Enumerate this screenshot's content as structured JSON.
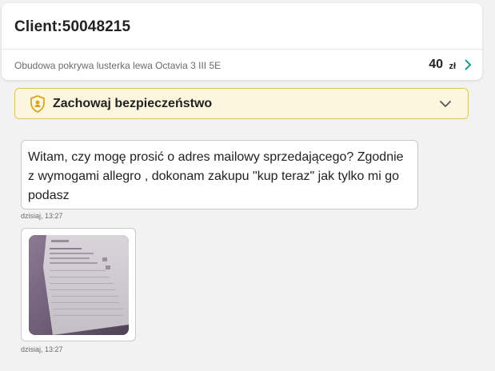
{
  "header": {
    "client_title": "Client:50048215",
    "offer_name": "Obudowa pokrywa lusterka lewa Octavia 3 III 5E",
    "offer_price": "40",
    "offer_currency": "zł"
  },
  "safety": {
    "label": "Zachowaj bezpieczeństwo",
    "icon": "shield-lock-icon",
    "expand_icon": "chevron-down-icon"
  },
  "messages": [
    {
      "text": "Witam, czy mogę prosić o adres mailowy sprzedającego? Zgodnie z wymogami allegro , dokonam zakupu \"kup teraz\" jak tylko mi go podasz",
      "time": "dzisiaj, 13:27"
    },
    {
      "attachment": "image",
      "time": "dzisiaj, 13:27"
    }
  ],
  "colors": {
    "accent": "#1a9e8f",
    "safety_bg": "#fdf6df",
    "safety_border": "#e8c25a",
    "safety_icon": "#d9a520"
  }
}
